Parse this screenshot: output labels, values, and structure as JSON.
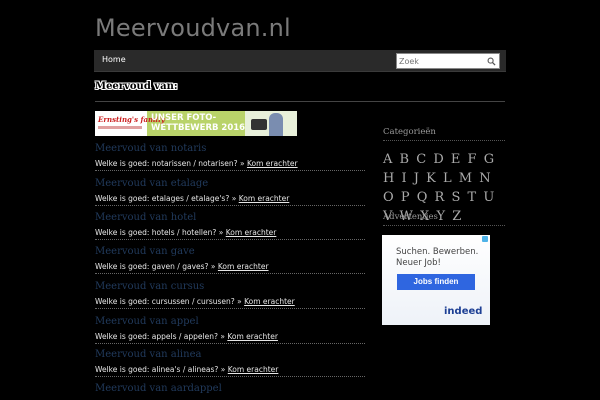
{
  "site": {
    "title": "Meervoudvan.nl"
  },
  "nav": {
    "home_label": "Home",
    "search_placeholder": "Zoek"
  },
  "page": {
    "heading": "Meervoud van:"
  },
  "banner": {
    "logo_text": "Ernsting's family",
    "headline": "UNSER FOTO-\nWETTBEWERB 2016"
  },
  "articles": [
    {
      "title": "Meervoud van notaris",
      "excerpt": "Welke is goed: notarissen / notarisen? »",
      "more": "Kom erachter"
    },
    {
      "title": "Meervoud van etalage",
      "excerpt": "Welke is goed: etalages / etalage's? »",
      "more": "Kom erachter"
    },
    {
      "title": "Meervoud van hotel",
      "excerpt": "Welke is goed: hotels / hotellen? »",
      "more": "Kom erachter"
    },
    {
      "title": "Meervoud van gave",
      "excerpt": "Welke is goed: gaven / gaves? »",
      "more": "Kom erachter"
    },
    {
      "title": "Meervoud van cursus",
      "excerpt": "Welke is goed: cursussen / cursusen? »",
      "more": "Kom erachter"
    },
    {
      "title": "Meervoud van appel",
      "excerpt": "Welke is goed: appels / appelen? »",
      "more": "Kom erachter"
    },
    {
      "title": "Meervoud van alinea",
      "excerpt": "Welke is goed: alinea's / alineas? »",
      "more": "Kom erachter"
    },
    {
      "title": "Meervoud van aardappel",
      "excerpt": "",
      "more": ""
    }
  ],
  "sidebar": {
    "categories_heading": "Categorieën",
    "letters": [
      "A",
      "B",
      "C",
      "D",
      "E",
      "F",
      "G",
      "H",
      "I",
      "J",
      "K",
      "L",
      "M",
      "N",
      "O",
      "P",
      "Q",
      "R",
      "S",
      "T",
      "U",
      "V",
      "W",
      "X",
      "Y",
      "Z"
    ],
    "ads_heading": "Advertenties"
  },
  "ad": {
    "text": "Suchen. Bewerben.\nNeuer Job!",
    "button": "Jobs finden",
    "logo": "indeed"
  }
}
